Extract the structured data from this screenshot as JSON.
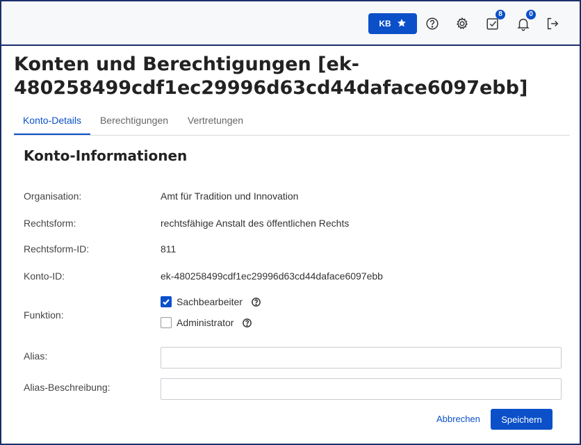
{
  "header": {
    "user_initials": "KB",
    "tasks_count": "8",
    "notifications_count": "0"
  },
  "page": {
    "title": "Konten und Berechtigungen [ek-480258499cdf1ec29996d63cd44daface6097ebb]"
  },
  "tabs": [
    {
      "label": "Konto-Details",
      "active": true
    },
    {
      "label": "Berechtigungen",
      "active": false
    },
    {
      "label": "Vertretungen",
      "active": false
    }
  ],
  "section": {
    "title": "Konto-Informationen"
  },
  "fields": {
    "organisation": {
      "label": "Organisation:",
      "value": "Amt für Tradition und Innovation"
    },
    "rechtsform": {
      "label": "Rechtsform:",
      "value": "rechtsfähige Anstalt des öffentlichen Rechts"
    },
    "rechtsform_id": {
      "label": "Rechtsform-ID:",
      "value": "811"
    },
    "konto_id": {
      "label": "Konto-ID:",
      "value": "ek-480258499cdf1ec29996d63cd44daface6097ebb"
    },
    "funktion": {
      "label": "Funktion:",
      "options": [
        {
          "label": "Sachbearbeiter",
          "checked": true
        },
        {
          "label": "Administrator",
          "checked": false
        }
      ]
    },
    "alias": {
      "label": "Alias:",
      "value": ""
    },
    "alias_beschreibung": {
      "label": "Alias-Beschreibung:",
      "value": ""
    }
  },
  "actions": {
    "cancel_label": "Abbrechen",
    "save_label": "Speichern"
  },
  "colors": {
    "accent": "#0b50c9",
    "frame": "#1a2f6a"
  },
  "icons": [
    "star-icon",
    "help-circle-icon",
    "gear-icon",
    "tasks-check-icon",
    "bell-icon",
    "logout-icon"
  ]
}
